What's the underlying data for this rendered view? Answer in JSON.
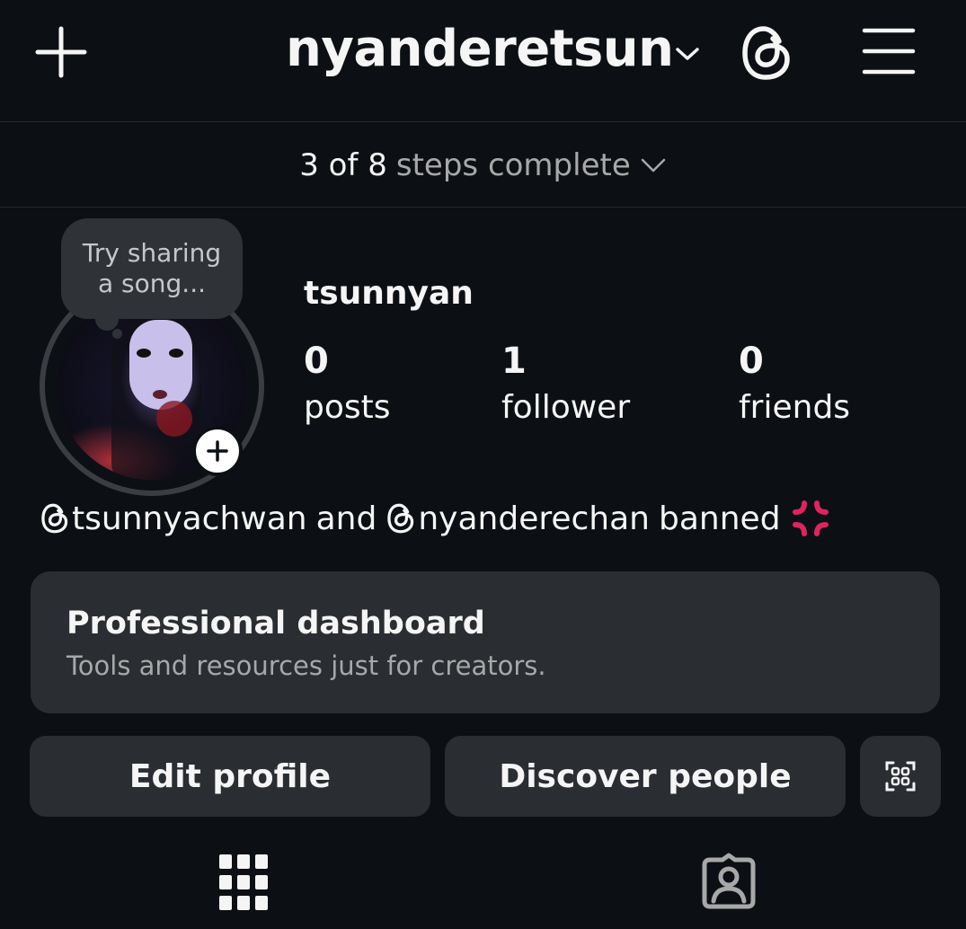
{
  "header": {
    "create_icon": "plus-icon",
    "account_name": "nyanderetsun",
    "account_switcher_icon": "chevron-down-icon",
    "threads_icon": "threads-icon",
    "menu_icon": "hamburger-menu-icon"
  },
  "onboarding": {
    "progress_text": "3 of 8",
    "progress_suffix": "steps complete",
    "completed_steps": 3,
    "total_steps": 8,
    "expand_icon": "chevron-down-icon"
  },
  "profile": {
    "note_bubble_line1": "Try sharing",
    "note_bubble_line2": "a song...",
    "display_name": "tsunnyan",
    "stats": [
      {
        "value": "0",
        "label": "posts"
      },
      {
        "value": "1",
        "label": "follower"
      },
      {
        "value": "0",
        "label": "friends"
      }
    ],
    "bio": {
      "mention1": "tsunnyachwan",
      "connector": "and",
      "mention2": "nyanderechan",
      "suffix": "banned",
      "emoji": "anger-symbol-emoji"
    }
  },
  "professional_dashboard": {
    "title": "Professional dashboard",
    "subtitle": "Tools and resources just for creators."
  },
  "actions": {
    "edit_profile": "Edit profile",
    "discover_people": "Discover people",
    "qr_icon": "qr-code-icon"
  },
  "tabs": {
    "grid_icon": "grid-icon",
    "tagged_icon": "tagged-person-icon"
  },
  "colors": {
    "background": "#0c1014",
    "surface": "#2a2d32",
    "text_primary": "#f5f5f5",
    "text_secondary": "#a8a8a8",
    "emoji_red": "#e0245e"
  }
}
